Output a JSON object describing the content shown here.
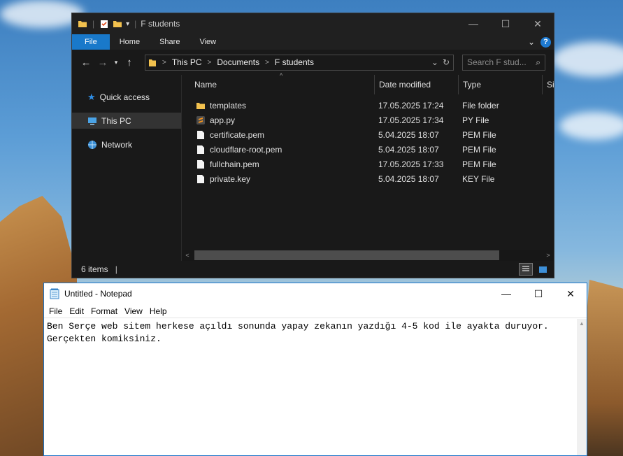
{
  "explorer": {
    "title": "F students",
    "ribbon_tabs": [
      "File",
      "Home",
      "Share",
      "View"
    ],
    "breadcrumb": [
      "This PC",
      "Documents",
      "F students"
    ],
    "search_placeholder": "Search F stud...",
    "nav_items": [
      {
        "label": "Quick access",
        "icon": "star-icon"
      },
      {
        "label": "This PC",
        "icon": "computer-icon"
      },
      {
        "label": "Network",
        "icon": "network-icon"
      }
    ],
    "columns": [
      "Name",
      "Date modified",
      "Type",
      "Siz"
    ],
    "files": [
      {
        "name": "templates",
        "date": "17.05.2025 17:24",
        "type": "File folder",
        "icon": "folder-icon"
      },
      {
        "name": "app.py",
        "date": "17.05.2025 17:34",
        "type": "PY File",
        "icon": "sublime-file-icon"
      },
      {
        "name": "certificate.pem",
        "date": "5.04.2025 18:07",
        "type": "PEM File",
        "icon": "file-icon"
      },
      {
        "name": "cloudflare-root.pem",
        "date": "5.04.2025 18:07",
        "type": "PEM File",
        "icon": "file-icon"
      },
      {
        "name": "fullchain.pem",
        "date": "17.05.2025 17:33",
        "type": "PEM File",
        "icon": "file-icon"
      },
      {
        "name": "private.key",
        "date": "5.04.2025 18:07",
        "type": "KEY File",
        "icon": "file-icon"
      }
    ],
    "status": "6 items",
    "status_cursor": "|"
  },
  "notepad": {
    "title": "Untitled - Notepad",
    "menu": [
      "File",
      "Edit",
      "Format",
      "View",
      "Help"
    ],
    "content": "Ben Serçe web sitem herkese açıldı sonunda yapay zekanın yazdığı 4-5 kod ile ayakta duruyor.\nGerçekten komiksiniz."
  },
  "colors": {
    "accent": "#1979ca",
    "explorer_bg": "#191919",
    "folder": "#f2c14e"
  }
}
